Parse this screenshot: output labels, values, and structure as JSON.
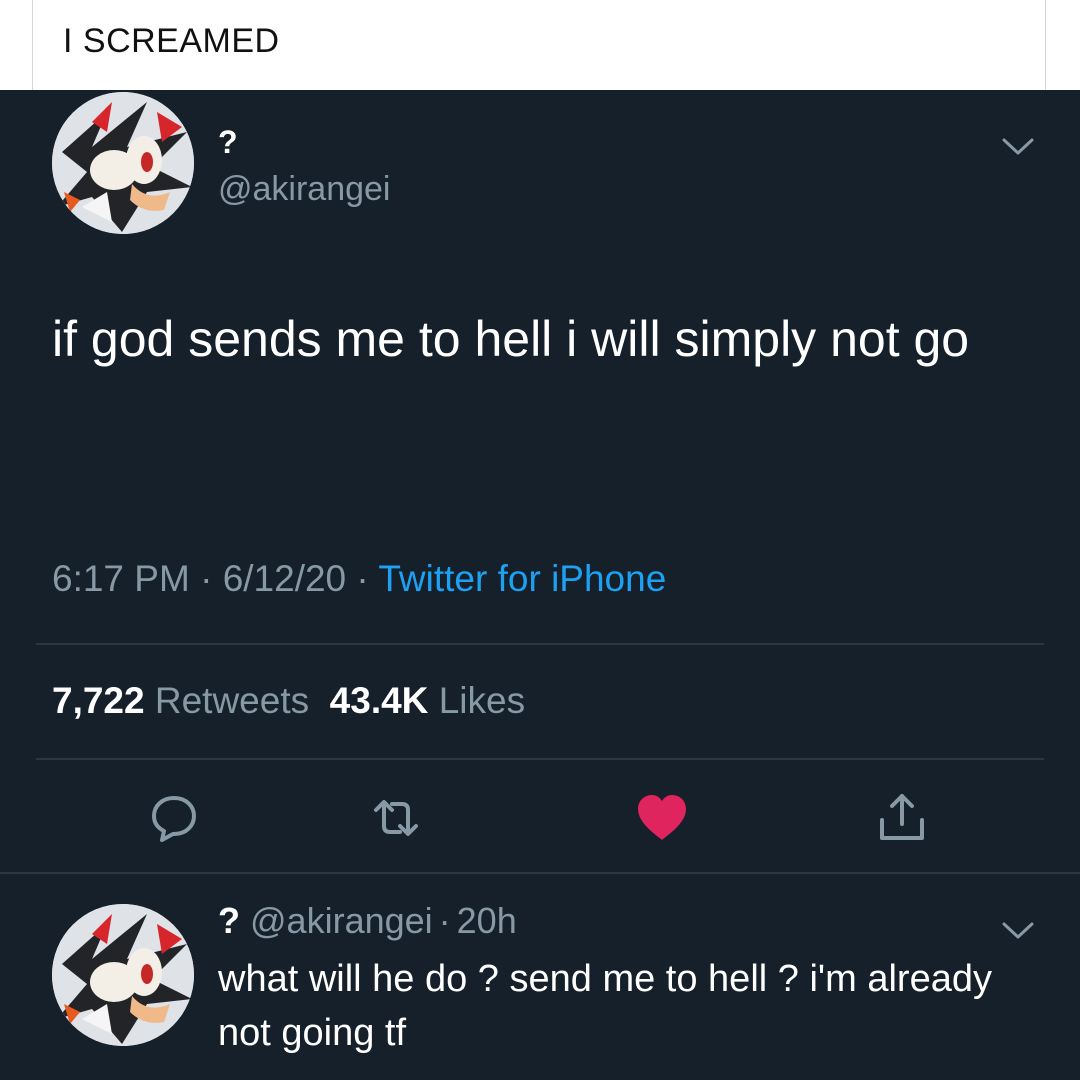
{
  "caption": {
    "text": "I SCREAMED"
  },
  "tweet": {
    "name": "?",
    "handle": "@akirangei",
    "text": "if god sends me to hell i will simply not go",
    "time": "6:17 PM",
    "date": "6/12/20",
    "separator": "·",
    "source": "Twitter for iPhone",
    "retweets_count": "7,722",
    "retweets_label": "Retweets",
    "likes_count": "43.4K",
    "likes_label": "Likes"
  },
  "actions": [
    {
      "icon": "reply-icon"
    },
    {
      "icon": "retweet-icon"
    },
    {
      "icon": "heart-icon",
      "state": "liked"
    },
    {
      "icon": "share-icon"
    }
  ],
  "reply": {
    "name": "?",
    "handle": "@akirangei",
    "age": "20h",
    "separator": "·",
    "text": "what will he do ? send me to hell ? i'm already not going tf"
  },
  "colors": {
    "background": "#15202b",
    "muted_text": "#8899a6",
    "link": "#1da1f2",
    "like": "#e0245e",
    "divider": "#2a3744"
  }
}
